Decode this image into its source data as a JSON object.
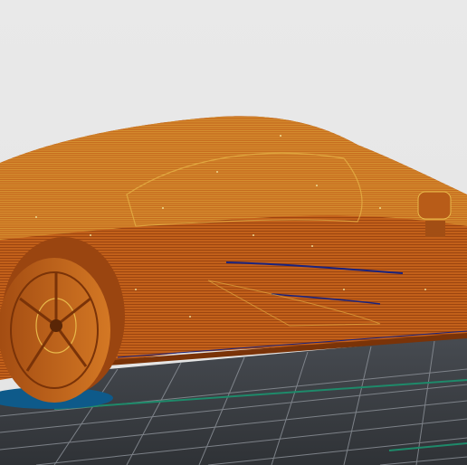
{
  "app": {
    "kind": "3d-print-slicer-preview"
  },
  "scene": {
    "model_name_icon": "sports-car-model",
    "background_color": "#e6e6e6",
    "bed_color": "#3a3d42",
    "grid_line_color": "#8a8f96",
    "model_primary_color": "#c8641c",
    "model_dark_color": "#8f3e0c",
    "model_highlight_color": "#e8b84a",
    "travel_line_color": "#1a237e",
    "support_shadow_color": "#0e5a8a",
    "bed_edge_accent_color": "#1e8a6a"
  }
}
